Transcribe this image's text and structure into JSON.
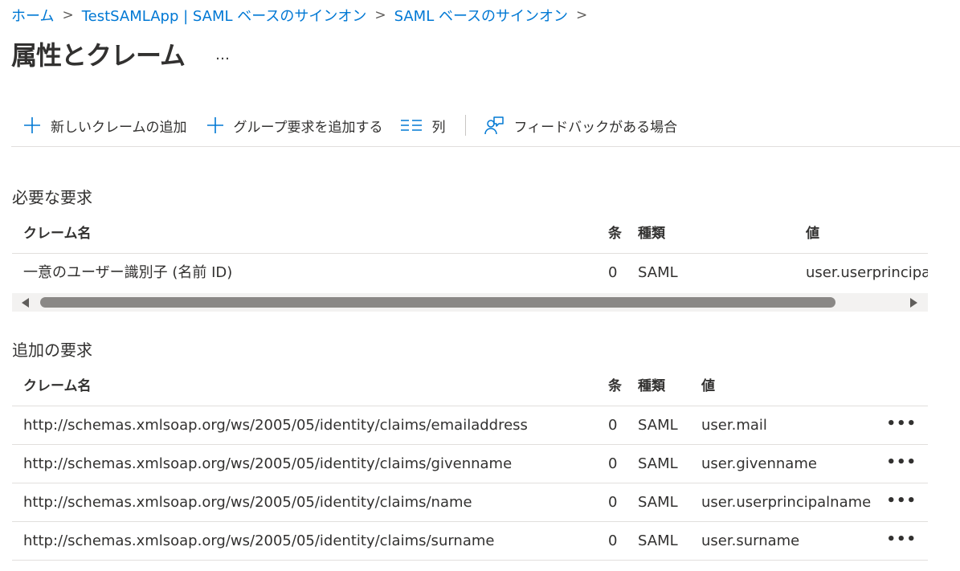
{
  "breadcrumb": {
    "items": [
      "ホーム",
      "TestSAMLApp | SAML ベースのサインオン",
      "SAML ベースのサインオン"
    ],
    "separator": ">"
  },
  "page": {
    "title": "属性とクレーム",
    "more": "…"
  },
  "toolbar": {
    "add_claim": "新しいクレームの追加",
    "add_group": "グループ要求を追加する",
    "columns": "列",
    "feedback": "フィードバックがある場合"
  },
  "required": {
    "title": "必要な要求",
    "headers": {
      "name": "クレーム名",
      "cond": "条",
      "type": "種類",
      "value": "値"
    },
    "rows": [
      {
        "name": "一意のユーザー識別子 (名前 ID)",
        "cond": "0",
        "type": "SAML",
        "value": "user.userprincipalname"
      }
    ]
  },
  "additional": {
    "title": "追加の要求",
    "headers": {
      "name": "クレーム名",
      "cond": "条",
      "type": "種類",
      "value": "値"
    },
    "row_more": "•••",
    "rows": [
      {
        "name": "http://schemas.xmlsoap.org/ws/2005/05/identity/claims/emailaddress",
        "cond": "0",
        "type": "SAML",
        "value": "user.mail"
      },
      {
        "name": "http://schemas.xmlsoap.org/ws/2005/05/identity/claims/givenname",
        "cond": "0",
        "type": "SAML",
        "value": "user.givenname"
      },
      {
        "name": "http://schemas.xmlsoap.org/ws/2005/05/identity/claims/name",
        "cond": "0",
        "type": "SAML",
        "value": "user.userprincipalname"
      },
      {
        "name": "http://schemas.xmlsoap.org/ws/2005/05/identity/claims/surname",
        "cond": "0",
        "type": "SAML",
        "value": "user.surname"
      }
    ]
  },
  "colors": {
    "link": "#0078d4",
    "text": "#323130",
    "border": "#e1dfdd"
  }
}
